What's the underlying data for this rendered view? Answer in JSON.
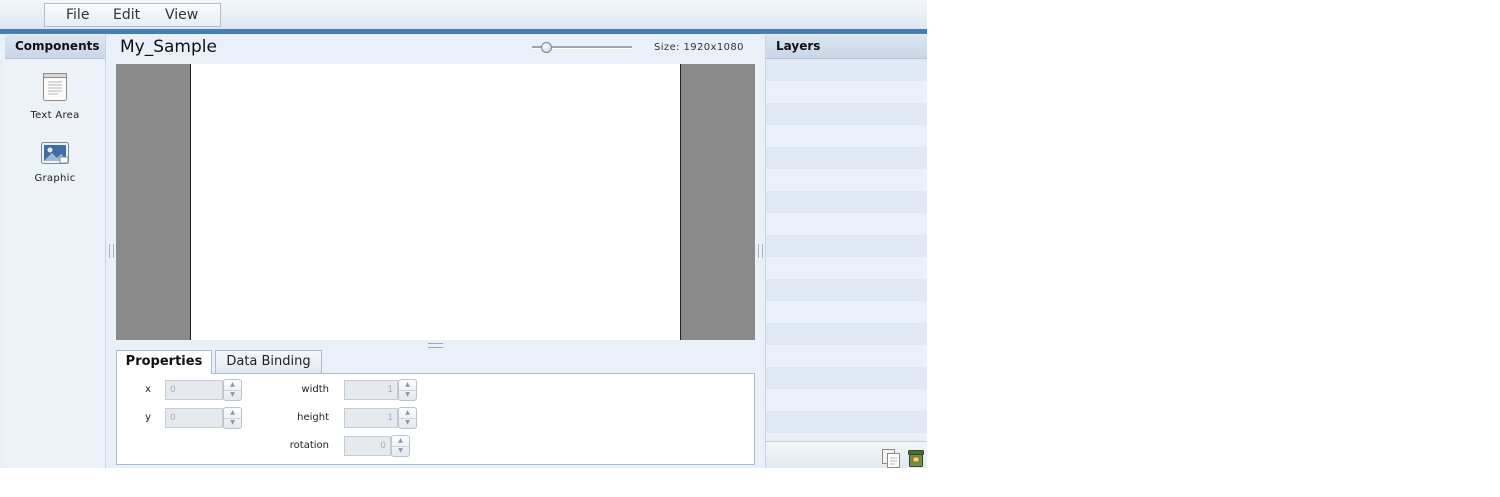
{
  "menu": {
    "items": [
      "File",
      "Edit",
      "View"
    ]
  },
  "components_panel": {
    "title": "Components",
    "items": [
      {
        "label": "Text Area",
        "icon": "text-area-icon"
      },
      {
        "label": "Graphic",
        "icon": "graphic-icon"
      }
    ]
  },
  "document": {
    "title": "My_Sample",
    "size_label": "Size: 1920x1080",
    "zoom_level": 0.1
  },
  "properties": {
    "tabs": [
      {
        "label": "Properties",
        "active": true
      },
      {
        "label": "Data Binding",
        "active": false
      }
    ],
    "fields": {
      "x": {
        "label": "x",
        "value": "0"
      },
      "y": {
        "label": "y",
        "value": "0"
      },
      "width": {
        "label": "width",
        "value": "1"
      },
      "height": {
        "label": "height",
        "value": "1"
      },
      "rotation": {
        "label": "rotation",
        "value": "0"
      }
    }
  },
  "layers_panel": {
    "title": "Layers",
    "footer_icons": [
      "duplicate-layer-icon",
      "delete-layer-icon"
    ]
  },
  "colors": {
    "accent": "#4a7cb7",
    "canvas_bg": "#8a8a8a",
    "panel_bg": "#e9f0f8"
  }
}
